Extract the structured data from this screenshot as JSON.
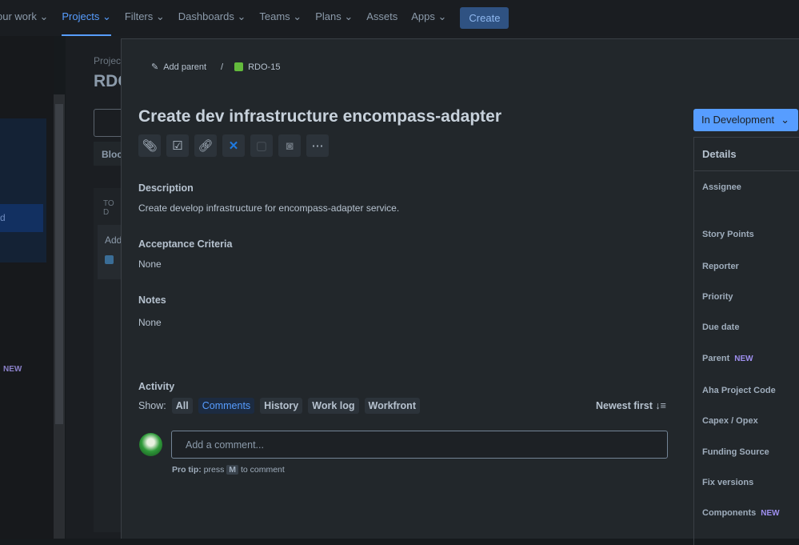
{
  "nav": {
    "items": [
      "our work",
      "Projects",
      "Filters",
      "Dashboards",
      "Teams",
      "Plans",
      "Assets",
      "Apps"
    ],
    "create": "Create"
  },
  "bg": {
    "crumb": "Projec",
    "key": "RDO",
    "block": "Bloc",
    "col": "TO D",
    "card": "Add",
    "new": "NEW",
    "side_sel": "d"
  },
  "modal": {
    "add_parent": "Add parent",
    "sep": "/",
    "issue_key": "RDO-15",
    "title": "Create dev infrastructure encompass-adapter",
    "status": "In Development",
    "description_h": "Description",
    "description": "Create develop infrastructure for encompass-adapter service.",
    "ac_h": "Acceptance Criteria",
    "ac": "None",
    "notes_h": "Notes",
    "notes": "None",
    "activity_h": "Activity",
    "show": "Show:",
    "filters": [
      "All",
      "Comments",
      "History",
      "Work log",
      "Workfront"
    ],
    "sort": "Newest first",
    "comment_placeholder": "Add a comment...",
    "protip_b": "Pro tip:",
    "protip_1": "press",
    "protip_key": "M",
    "protip_2": "to comment",
    "details_h": "Details",
    "fields": [
      "Assignee",
      "Story Points",
      "Reporter",
      "Priority",
      "Due date",
      "Parent",
      "Aha Project Code",
      "Capex / Opex",
      "Funding Source",
      "Fix versions",
      "Components"
    ],
    "new_badge": "NEW"
  }
}
